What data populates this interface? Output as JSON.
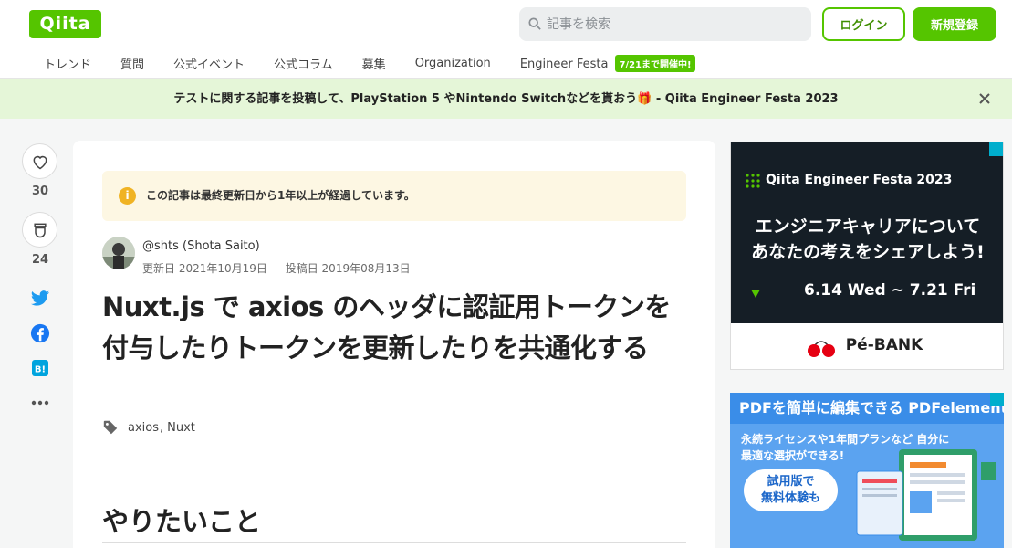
{
  "header": {
    "logo": "Qiita",
    "search_placeholder": "記事を検索",
    "login_label": "ログイン",
    "signup_label": "新規登録",
    "nav": [
      {
        "label": "トレンド"
      },
      {
        "label": "質問"
      },
      {
        "label": "公式イベント"
      },
      {
        "label": "公式コラム"
      },
      {
        "label": "募集"
      },
      {
        "label": "Organization"
      },
      {
        "label": "Engineer Festa",
        "badge": "7/21まで開催中!"
      }
    ]
  },
  "banner": {
    "text": "テストに関する記事を投稿して、PlayStation 5 やNintendo Switchなどを貰おう🎁 - Qiita Engineer Festa 2023"
  },
  "side": {
    "likes": "30",
    "stocks": "24"
  },
  "article": {
    "notice": "この記事は最終更新日から1年以上が経過しています。",
    "notice_icon": "i",
    "author": "@shts (Shota Saito)",
    "updated": "更新日 2021年10月19日",
    "posted": "投稿日 2019年08月13日",
    "title": "Nuxt.js で axios のヘッダに認証用トークンを付与したりトークンを更新したりを共通化する",
    "tags": [
      {
        "label": "axios"
      },
      {
        "label": "Nuxt"
      }
    ],
    "tag_separator": ",",
    "heading": "やりたいこと"
  },
  "ads": {
    "ad1": {
      "brand": "Qiita Engineer Festa 2023",
      "line1": "エンジニアキャリアについて",
      "line2": "あなたの考えをシェアしよう!",
      "dates": "6.14 Wed ~ 7.21 Fri",
      "sponsor": "Pé-BANK"
    },
    "ad2": {
      "title": "PDFを簡単に編集できる PDFelement",
      "sub": "永続ライセンスや1年間プランなど 自分に最適な選択ができる!",
      "cta1": "試用版で",
      "cta2": "無料体験も"
    }
  },
  "colors": {
    "brand": "#55c500",
    "banner_bg": "#e5f6d8",
    "notice_bg": "#fdf7e3",
    "twitter": "#1d9bf0",
    "facebook": "#1877f2",
    "hatena": "#00a4de"
  }
}
